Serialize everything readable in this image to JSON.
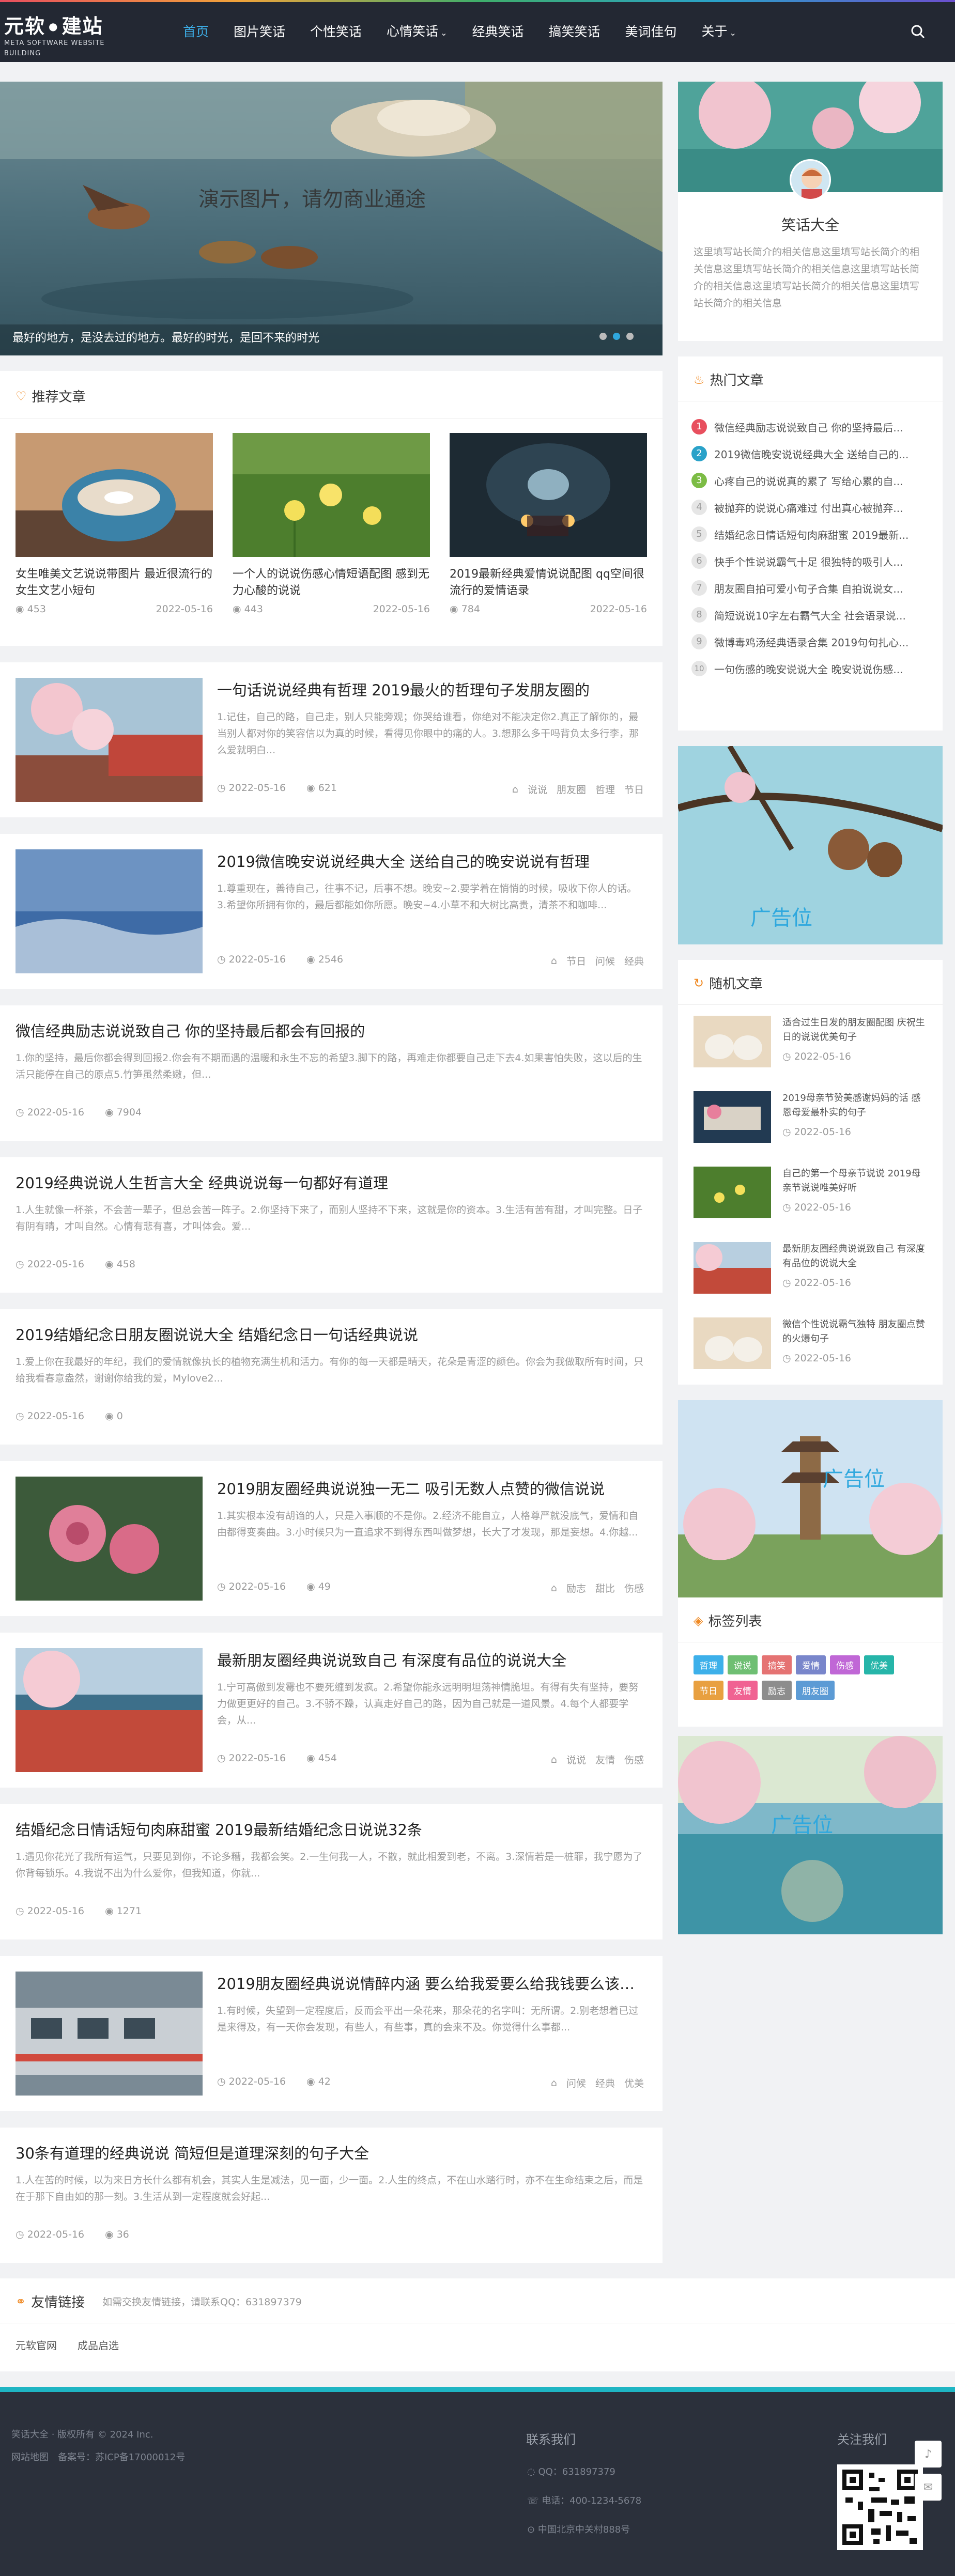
{
  "logo": {
    "name": "元软",
    "name2": "建站",
    "sub": "META SOFTWARE WEBSITE BUILDING"
  },
  "nav": [
    {
      "label": "首页"
    },
    {
      "label": "图片笑话"
    },
    {
      "label": "个性笑话"
    },
    {
      "label": "心情笑话",
      "caret": "⌄"
    },
    {
      "label": "经典笑话"
    },
    {
      "label": "搞笑笑话"
    },
    {
      "label": "美词佳句"
    },
    {
      "label": "关于",
      "caret": "⌄"
    }
  ],
  "banner": {
    "overlay": "演示图片，请勿商业通途",
    "caption": "最好的地方，是没去过的地方。最好的时光，是回不来的时光"
  },
  "recommend": {
    "title": "推荐文章",
    "items": [
      {
        "title": "女生唯美文艺说说带图片 最近很流行的女生文艺小短句",
        "views": "453",
        "date": "2022-05-16"
      },
      {
        "title": "一个人的说说伤感心情短语配图 感到无力心酸的说说",
        "views": "443",
        "date": "2022-05-16"
      },
      {
        "title": "2019最新经典爱情说说配图 qq空间很流行的爱情语录",
        "views": "784",
        "date": "2022-05-16"
      }
    ]
  },
  "posts": [
    {
      "title": "一句话说说经典有哲理 2019最火的哲理句子发朋友圈的",
      "excerpt": "1.记住，自己的路，自己走，别人只能旁观；你哭给谁看，你绝对不能决定你2.真正了解你的，最当别人都对你的笑容信以为真的时候，看得见你眼中的痛的人。3.想那么多干吗背负太多行李，那么爱就明白...",
      "date": "2022-05-16",
      "views": "621",
      "tags": [
        "说说",
        "朋友圈",
        "哲理",
        "节日"
      ]
    },
    {
      "title": "2019微信晚安说说经典大全 送给自己的晚安说说有哲理",
      "excerpt": "1.尊重现在，善待自己，往事不记，后事不想。晚安~2.要学着在悄悄的时候，吸收下你人的话。3.希望你所拥有你的，最后都能如你所愿。晚安~4.小草不和大树比高贵，清茶不和咖啡...",
      "date": "2022-05-16",
      "views": "2546",
      "tags": [
        "节日",
        "问候",
        "经典"
      ]
    },
    {
      "title": "微信经典励志说说致自己 你的坚持最后都会有回报的",
      "excerpt": "1.你的坚持，最后你都会得到回报2.你会有不期而遇的温暖和永生不忘的希望3.脚下的路，再难走你都要自己走下去4.如果害怕失败，这以后的生活只能停在自己的原点5.竹笋虽然柔嫩，但...",
      "date": "2022-05-16",
      "views": "7904",
      "tags": []
    },
    {
      "title": "2019经典说说人生哲言大全 经典说说每一句都好有道理",
      "excerpt": "1.人生就像一杯茶，不会苦一辈子，但总会苦一阵子。2.你坚持下来了，而别人坚持不下来，这就是你的资本。3.生活有苦有甜，才叫完整。日子有阴有晴，才叫自然。心情有悲有喜，才叫体会。爱...",
      "date": "2022-05-16",
      "views": "458",
      "tags": []
    },
    {
      "title": "2019结婚纪念日朋友圈说说大全 结婚纪念日一句话经典说说",
      "excerpt": "1.爱上你在我最好的年纪，我们的爱情就像执长的植物充满生机和活力。有你的每一天都是晴天，花朵是青涩的颜色。你会为我做取所有时间，只给我看春意盎然，谢谢你给我的爱，Mylove2...",
      "date": "2022-05-16",
      "views": "0",
      "tags": []
    },
    {
      "title": "2019朋友圈经典说说独一无二 吸引无数人点赞的微信说说",
      "excerpt": "1.其实根本没有胡诌的人，只是入事顺的不是你。2.经济不能自立，人格尊严就没底气，爱情和自由都得变奏曲。3.小时候只为一直追求不到得东西叫做梦想，长大了才发现，那是妄想。4.你越...",
      "date": "2022-05-16",
      "views": "49",
      "tags": [
        "励志",
        "甜比",
        "伤感"
      ]
    },
    {
      "title": "最新朋友圈经典说说致自己 有深度有品位的说说大全",
      "excerpt": "1.宁可高傲到发霉也不要死缠到发疯。2.希望你能永远明明坦荡神情脆坦。有得有失有坚持，要努力做更更好的自己。3.不骄不躁，认真走好自己的路，因为自己就是一道风景。4.每个人都要学会，从...",
      "date": "2022-05-16",
      "views": "454",
      "tags": [
        "说说",
        "友情",
        "伤感"
      ]
    },
    {
      "title": "结婚纪念日情话短句肉麻甜蜜 2019最新结婚纪念日说说32条",
      "excerpt": "1.遇见你花光了我所有运气，只要见到你，不论多糟，我都会笑。2.一生何我一人，不散，就此相爱到老，不离。3.深情若是一桩罪，我宁愿为了你背每锁乐。4.我说不出为什么爱你，但我知道，你就...",
      "date": "2022-05-16",
      "views": "1271",
      "tags": []
    },
    {
      "title": "2019朋友圈经典说说情醉内涵 要么给我爱要么给我钱要么该我...",
      "excerpt": "1.有时候，失望到一定程度后，反而会平出一朵花来，那朵花的名字叫：无所谓。2.别老想着已过是来得及，有一天你会发现，有些人，有些事，真的会来不及。你觉得什么事都...",
      "date": "2022-05-16",
      "views": "42",
      "tags": [
        "问候",
        "经典",
        "优美"
      ]
    },
    {
      "title": "30条有道理的经典说说 简短但是道理深刻的句子大全",
      "excerpt": "1.人在苦的时候，以为来日方长什么都有机会，其实人生是减法，见一面，少一面。2.人生的终点，不在山水踏行时，亦不在生命结束之后，而是在于那下自由如的那一刻。3.生活从到一定程度就会好起...",
      "date": "2022-05-16",
      "views": "36",
      "tags": []
    }
  ],
  "links": {
    "title": "友情链接",
    "note": "如需交换友情链接，请联系QQ：631897379",
    "items": [
      "元软官网",
      "成品启选"
    ]
  },
  "profile": {
    "name": "笑话大全",
    "desc": "这里填写站长简介的相关信息这里填写站长简介的相关信息这里填写站长简介的相关信息这里填写站长简介的相关信息这里填写站长简介的相关信息这里填写站长简介的相关信息"
  },
  "hot": {
    "title": "热门文章",
    "items": [
      {
        "n": "1",
        "t": "微信经典励志说说致自己 你的坚持最后..."
      },
      {
        "n": "2",
        "t": "2019微信晚安说说经典大全 送给自己的..."
      },
      {
        "n": "3",
        "t": "心疼自己的说说真的累了 写给心累的自..."
      },
      {
        "n": "4",
        "t": "被抛弃的说说心痛难过 付出真心被抛弃..."
      },
      {
        "n": "5",
        "t": "结婚纪念日情话短句肉麻甜蜜 2019最新..."
      },
      {
        "n": "6",
        "t": "快手个性说说霸气十足 很独特的吸引人..."
      },
      {
        "n": "7",
        "t": "朋友圈自拍可爱小句子合集 自拍说说女..."
      },
      {
        "n": "8",
        "t": "简短说说10字左右霸气大全 社会语录说..."
      },
      {
        "n": "9",
        "t": "微博毒鸡汤经典语录合集 2019句句扎心..."
      },
      {
        "n": "10",
        "t": "一句伤感的晚安说说大全 晚安说说伤感..."
      }
    ]
  },
  "ad": {
    "label": "广告位"
  },
  "random": {
    "title": "随机文章",
    "items": [
      {
        "t": "适合过生日发的朋友圈配图 庆祝生日的说说优美句子",
        "date": "2022-05-16"
      },
      {
        "t": "2019母亲节赞美感谢妈妈的话 感恩母爱最朴实的句子",
        "date": "2022-05-16"
      },
      {
        "t": "自己的第一个母亲节说说 2019母亲节说说唯美好听",
        "date": "2022-05-16"
      },
      {
        "t": "最新朋友圈经典说说致自己 有深度有品位的说说大全",
        "date": "2022-05-16"
      },
      {
        "t": "微信个性说说霸气独特 朋友圈点赞的火爆句子",
        "date": "2022-05-16"
      }
    ]
  },
  "tagcloud": {
    "title": "标签列表",
    "items": [
      {
        "t": "哲理",
        "c": "#3db0ea"
      },
      {
        "t": "说说",
        "c": "#6fbf73"
      },
      {
        "t": "搞笑",
        "c": "#e57373"
      },
      {
        "t": "爱情",
        "c": "#7986cb"
      },
      {
        "t": "伤感",
        "c": "#c067d6"
      },
      {
        "t": "优美",
        "c": "#26b5a9"
      },
      {
        "t": "节日",
        "c": "#e8a040"
      },
      {
        "t": "友情",
        "c": "#f06292"
      },
      {
        "t": "励志",
        "c": "#8d8d8d"
      },
      {
        "t": "朋友圈",
        "c": "#5c9bd5"
      }
    ]
  },
  "footer": {
    "copy": "笑话大全 · 版权所有 © 2024 Inc.",
    "map": "网站地图",
    "icp": "备案号：苏ICP备17000012号",
    "contact_title": "联系我们",
    "qq": "QQ：631897379",
    "phone": "电话：400-1234-5678",
    "addr": "中国北京中关村888号",
    "follow": "关注我们"
  }
}
